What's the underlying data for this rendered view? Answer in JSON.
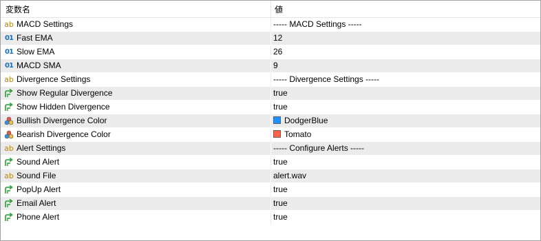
{
  "header": {
    "name_col": "変数名",
    "value_col": "値"
  },
  "rows": [
    {
      "icon": "ab-string-icon",
      "name": "MACD Settings",
      "value": "----- MACD Settings -----"
    },
    {
      "icon": "01-int-icon",
      "name": "Fast EMA",
      "value": "12"
    },
    {
      "icon": "01-int-icon",
      "name": "Slow EMA",
      "value": "26"
    },
    {
      "icon": "01-int-icon",
      "name": "MACD SMA",
      "value": "9"
    },
    {
      "icon": "ab-string-icon",
      "name": "Divergence Settings",
      "value": "----- Divergence Settings -----"
    },
    {
      "icon": "bool-arrow-icon",
      "name": "Show Regular Divergence",
      "value": "true"
    },
    {
      "icon": "bool-arrow-icon",
      "name": "Show Hidden Divergence",
      "value": "true"
    },
    {
      "icon": "color-palette-icon",
      "name": "Bullish Divergence Color",
      "value": "DodgerBlue",
      "color": "#1e90ff"
    },
    {
      "icon": "color-palette-icon",
      "name": "Bearish Divergence Color",
      "value": "Tomato",
      "color": "#ff6347"
    },
    {
      "icon": "ab-string-icon",
      "name": "Alert Settings",
      "value": "----- Configure Alerts -----"
    },
    {
      "icon": "bool-arrow-icon",
      "name": "Sound Alert",
      "value": "true"
    },
    {
      "icon": "ab-string-icon",
      "name": "Sound File",
      "value": "alert.wav"
    },
    {
      "icon": "bool-arrow-icon",
      "name": "PopUp Alert",
      "value": "true"
    },
    {
      "icon": "bool-arrow-icon",
      "name": "Email Alert",
      "value": "true"
    },
    {
      "icon": "bool-arrow-icon",
      "name": "Phone Alert",
      "value": "true"
    }
  ]
}
